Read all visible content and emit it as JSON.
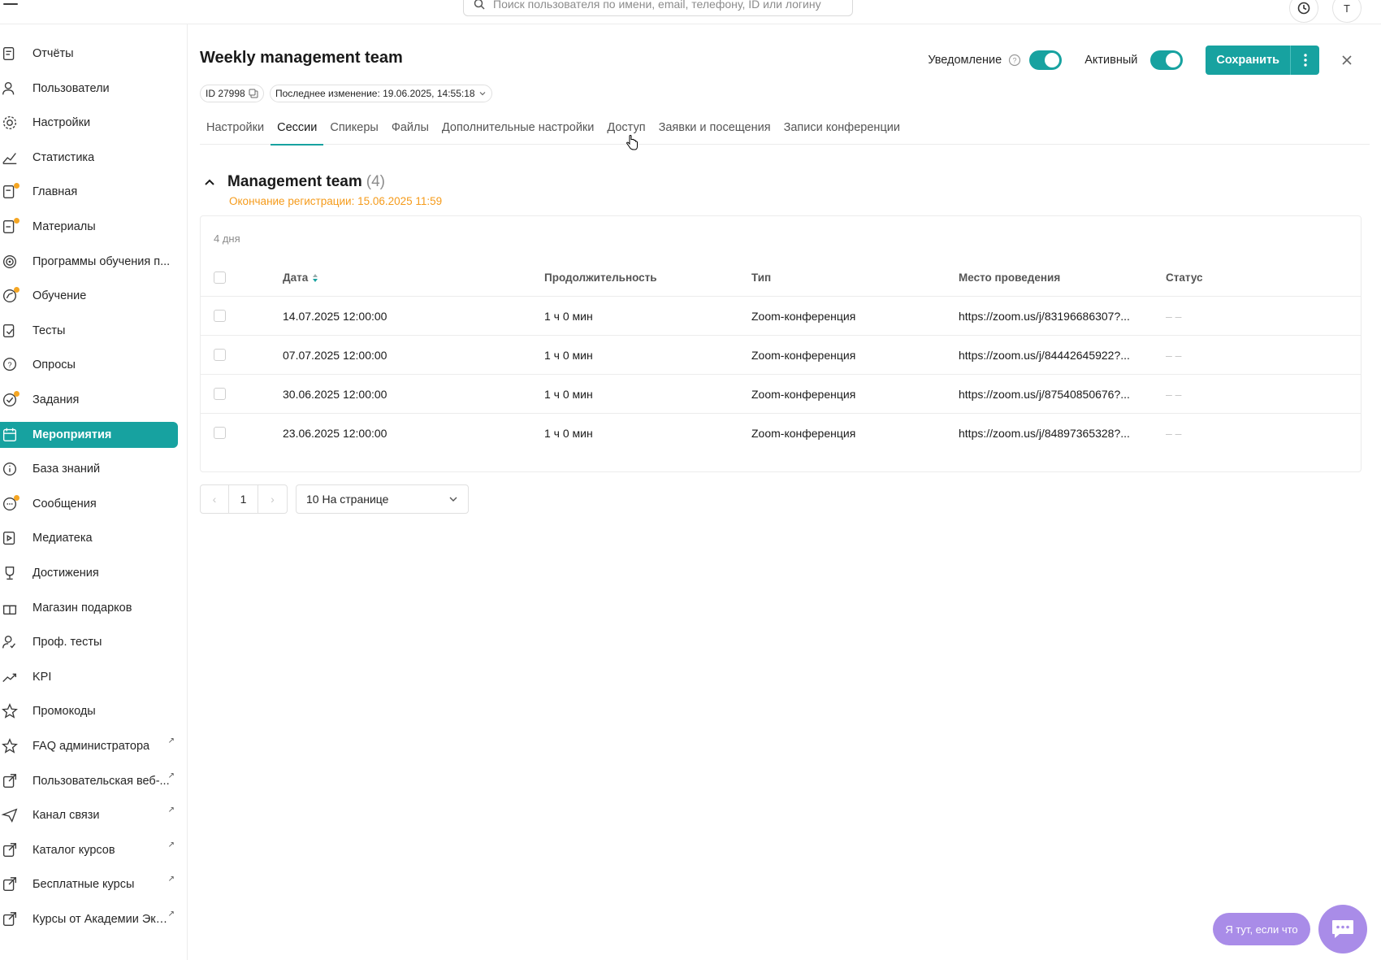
{
  "search": {
    "placeholder": "Поиск пользователя по имени, email, телефону, ID или логину"
  },
  "top": {
    "user_initial": "T"
  },
  "sidebar": {
    "items": [
      {
        "label": "Отчёты",
        "icon": "report-icon"
      },
      {
        "label": "Пользователи",
        "icon": "users-icon"
      },
      {
        "label": "Настройки",
        "icon": "gear-icon"
      },
      {
        "label": "Статистика",
        "icon": "chart-line-icon"
      },
      {
        "label": "Главная",
        "icon": "home-doc-icon"
      },
      {
        "label": "Материалы",
        "icon": "materials-icon"
      },
      {
        "label": "Программы обучения п...",
        "icon": "programs-icon"
      },
      {
        "label": "Обучение",
        "icon": "learning-icon"
      },
      {
        "label": "Тесты",
        "icon": "tests-icon"
      },
      {
        "label": "Опросы",
        "icon": "survey-icon"
      },
      {
        "label": "Задания",
        "icon": "tasks-icon"
      },
      {
        "label": "Мероприятия",
        "icon": "calendar-icon"
      },
      {
        "label": "База знаний",
        "icon": "info-icon"
      },
      {
        "label": "Сообщения",
        "icon": "messages-icon"
      },
      {
        "label": "Медиатека",
        "icon": "media-icon"
      },
      {
        "label": "Достижения",
        "icon": "trophy-icon"
      },
      {
        "label": "Магазин подарков",
        "icon": "gift-icon"
      },
      {
        "label": "Проф. тесты",
        "icon": "prof-test-icon"
      },
      {
        "label": "KPI",
        "icon": "trend-icon"
      },
      {
        "label": "Промокоды",
        "icon": "star-icon"
      },
      {
        "label": "FAQ администратора",
        "icon": "star-icon"
      },
      {
        "label": "Пользовательская веб-...",
        "icon": "external-link-icon"
      },
      {
        "label": "Канал связи",
        "icon": "send-icon"
      },
      {
        "label": "Каталог курсов",
        "icon": "external-link-icon"
      },
      {
        "label": "Бесплатные курсы",
        "icon": "external-link-icon"
      },
      {
        "label": "Курсы от Академии Экв...",
        "icon": "external-link-icon"
      }
    ]
  },
  "header": {
    "title": "Weekly management team",
    "id_chip": "ID 27998",
    "last_change": "Последнее изменение: 19.06.2025, 14:55:18",
    "notify_label": "Уведомление",
    "active_label": "Активный",
    "save_label": "Сохранить"
  },
  "tabs": [
    "Настройки",
    "Сессии",
    "Спикеры",
    "Файлы",
    "Дополнительные настройки",
    "Доступ",
    "Заявки и посещения",
    "Записи конференции"
  ],
  "group": {
    "title": "Management team",
    "count": "(4)",
    "reg_end": "Окончание регистрации: 15.06.2025 11:59",
    "days": "4 дня"
  },
  "table": {
    "columns": [
      "Дата",
      "Продолжительность",
      "Тип",
      "Место проведения",
      "Статус"
    ],
    "rows": [
      {
        "date": "14.07.2025 12:00:00",
        "duration": "1 ч 0 мин",
        "type": "Zoom-конференция",
        "place": "https://zoom.us/j/83196686307?...",
        "status": "– –"
      },
      {
        "date": "07.07.2025 12:00:00",
        "duration": "1 ч 0 мин",
        "type": "Zoom-конференция",
        "place": "https://zoom.us/j/84442645922?...",
        "status": "– –"
      },
      {
        "date": "30.06.2025 12:00:00",
        "duration": "1 ч 0 мин",
        "type": "Zoom-конференция",
        "place": "https://zoom.us/j/87540850676?...",
        "status": "– –"
      },
      {
        "date": "23.06.2025 12:00:00",
        "duration": "1 ч 0 мин",
        "type": "Zoom-конференция",
        "place": "https://zoom.us/j/84897365328?...",
        "status": "– –"
      }
    ]
  },
  "pager": {
    "prev": "‹",
    "page": "1",
    "next": "›",
    "per_page": "10 На странице"
  },
  "help": {
    "pill": "Я тут, если что"
  },
  "colors": {
    "accent": "#17a2a0",
    "warning": "#f59b1b",
    "assistant": "#a98ce8"
  }
}
